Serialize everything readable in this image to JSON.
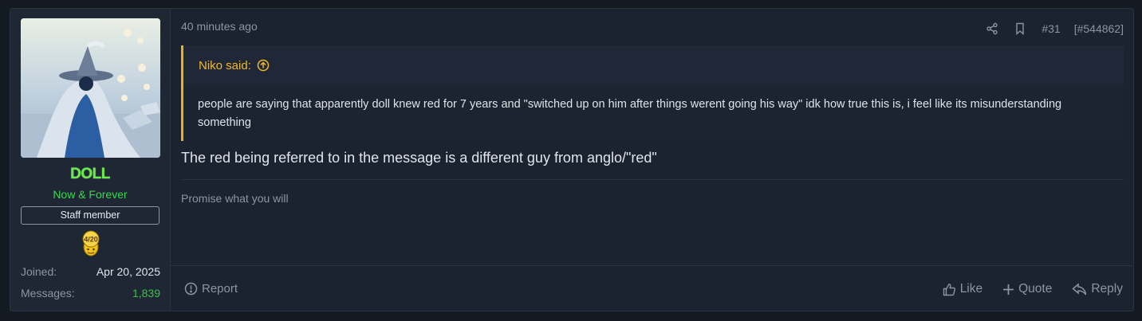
{
  "user": {
    "name": "DOLL",
    "title": "Now & Forever",
    "badge": "Staff member",
    "trophy_text": "4/20",
    "stats": [
      {
        "label": "Joined:",
        "value": "Apr 20, 2025"
      },
      {
        "label": "Messages:",
        "value": "1,839"
      }
    ]
  },
  "post": {
    "timestamp": "40 minutes ago",
    "number": "#31",
    "post_id": "[#544862]",
    "quote": {
      "author": "Niko said:",
      "text": "people are saying that apparently doll knew red for 7 years and \"switched up on him after things werent going his way\" idk how true this is, i feel like its misunderstanding something"
    },
    "message": "The red being referred to in the message is a different guy from anglo/\"red\"",
    "signature": "Promise what you will"
  },
  "actions": {
    "report": "Report",
    "like": "Like",
    "quote": "Quote",
    "reply": "Reply"
  },
  "colors": {
    "accent_quote": "#e9b21c",
    "username": "#6bea4d",
    "user_title": "#38d94b",
    "messages_count": "#39c24a"
  }
}
